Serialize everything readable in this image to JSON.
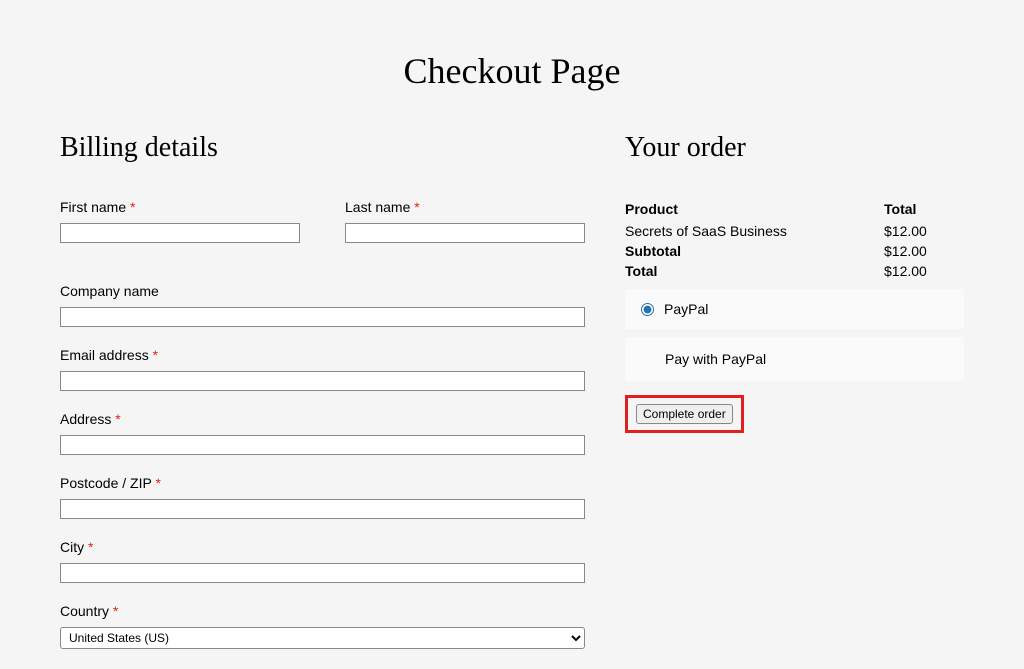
{
  "page": {
    "title": "Checkout Page"
  },
  "billing": {
    "heading": "Billing details",
    "first_name_label": "First name ",
    "last_name_label": "Last name ",
    "company_label": "Company name",
    "email_label": "Email address ",
    "address_label": "Address ",
    "postcode_label": "Postcode / ZIP ",
    "city_label": "City ",
    "country_label": "Country ",
    "country_value": "United States (US)",
    "required_marker": "*"
  },
  "order": {
    "heading": "Your order",
    "product_header": "Product",
    "total_header": "Total",
    "item_name": "Secrets of SaaS Business",
    "item_price": "$12.00",
    "subtotal_label": "Subtotal",
    "subtotal_value": "$12.00",
    "total_label": "Total",
    "total_value": "$12.00",
    "payment_option_label": "PayPal",
    "payment_description": "Pay with PayPal",
    "complete_button": "Complete order"
  }
}
